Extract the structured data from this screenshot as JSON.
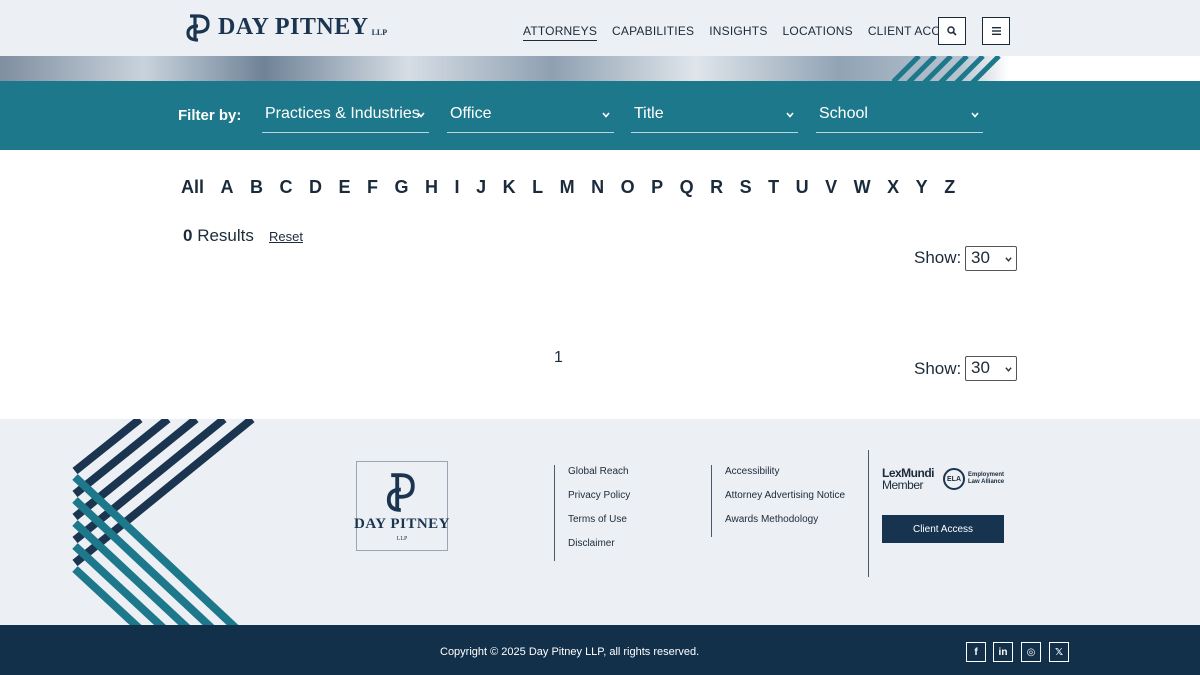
{
  "header": {
    "logo_text": "DAY PITNEY",
    "logo_suffix": "LLP",
    "nav": [
      "ATTORNEYS",
      "CAPABILITIES",
      "INSIGHTS",
      "LOCATIONS",
      "CLIENT ACCESS"
    ],
    "search_icon": "search-icon",
    "menu_icon": "hamburger-menu-icon"
  },
  "filter": {
    "label": "Filter by:",
    "selects": [
      "Practices & Industries",
      "Office",
      "Title",
      "School"
    ]
  },
  "alphabet": [
    "All",
    "A",
    "B",
    "C",
    "D",
    "E",
    "F",
    "G",
    "H",
    "I",
    "J",
    "K",
    "L",
    "M",
    "N",
    "O",
    "P",
    "Q",
    "R",
    "S",
    "T",
    "U",
    "V",
    "W",
    "X",
    "Y",
    "Z"
  ],
  "results": {
    "count": "0",
    "label": "Results",
    "reset": "Reset"
  },
  "show": {
    "label": "Show:",
    "value": "30"
  },
  "pagination": {
    "current": "1"
  },
  "footer": {
    "logo_text": "DAY PITNEY",
    "logo_suffix": "LLP",
    "col1": [
      "Global Reach",
      "Privacy Policy",
      "Terms of Use",
      "Disclaimer"
    ],
    "col2": [
      "Accessibility",
      "Attorney Advertising Notice",
      "Awards Methodology"
    ],
    "lexmundi_line1": "LexMundi",
    "lexmundi_line2": "Member",
    "ela_badge": "ELA",
    "ela_line1": "Employment",
    "ela_line2": "Law Alliance",
    "client_access": "Client Access",
    "copyright": "Copyright © 2025 Day Pitney LLP, all rights reserved.",
    "social": [
      "f",
      "in",
      "◎",
      "𝕏"
    ]
  },
  "colors": {
    "teal": "#1d788b",
    "navy": "#13304a",
    "light_gray": "#eceff3"
  }
}
